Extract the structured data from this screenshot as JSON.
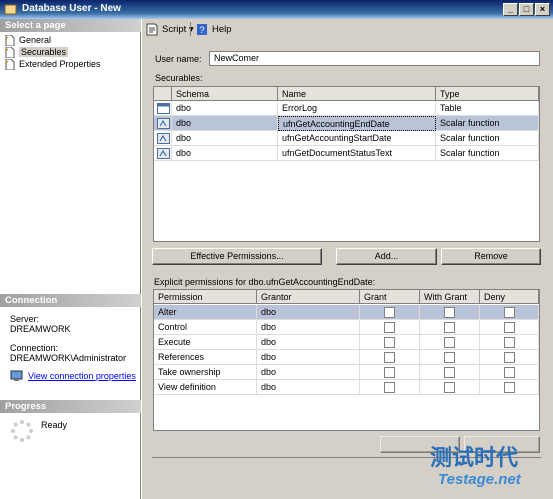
{
  "window": {
    "title": "Database User - New"
  },
  "left": {
    "select_page_header": "Select a page",
    "pages": [
      {
        "label": "General",
        "icon": "page-icon"
      },
      {
        "label": "Securables",
        "icon": "page-icon"
      },
      {
        "label": "Extended Properties",
        "icon": "page-icon"
      }
    ],
    "connection_header": "Connection",
    "server_label": "Server:",
    "server_value": "DREAMWORK",
    "connection_label": "Connection:",
    "connection_value": "DREAMWORK\\Administrator",
    "view_connection_properties": "View connection properties",
    "progress_header": "Progress",
    "progress_status": "Ready"
  },
  "toolbar": {
    "script_label": "Script",
    "help_label": "Help"
  },
  "form": {
    "user_name_label": "User name:",
    "user_name_value": "NewComer",
    "securables_label": "Securables:"
  },
  "securables": {
    "columns": [
      "Schema",
      "Name",
      "Type"
    ],
    "rows": [
      {
        "schema": "dbo",
        "name": "ErrorLog",
        "type": "Table",
        "icon": "table-icon"
      },
      {
        "schema": "dbo",
        "name": "ufnGetAccountingEndDate",
        "type": "Scalar function",
        "icon": "function-icon"
      },
      {
        "schema": "dbo",
        "name": "ufnGetAccountingStartDate",
        "type": "Scalar function",
        "icon": "function-icon"
      },
      {
        "schema": "dbo",
        "name": "ufnGetDocumentStatusText",
        "type": "Scalar function",
        "icon": "function-icon"
      }
    ],
    "selected_row": 1
  },
  "buttons": {
    "effective_permissions": "Effective Permissions...",
    "add": "Add...",
    "remove": "Remove"
  },
  "permissions": {
    "caption": "Explicit permissions for dbo.ufnGetAccountingEndDate:",
    "columns": [
      "Permission",
      "Grantor",
      "Grant",
      "With Grant",
      "Deny"
    ],
    "rows": [
      {
        "permission": "Alter",
        "grantor": "dbo",
        "grant": false,
        "with_grant": false,
        "deny": false
      },
      {
        "permission": "Control",
        "grantor": "dbo",
        "grant": false,
        "with_grant": false,
        "deny": false
      },
      {
        "permission": "Execute",
        "grantor": "dbo",
        "grant": false,
        "with_grant": false,
        "deny": false
      },
      {
        "permission": "References",
        "grantor": "dbo",
        "grant": false,
        "with_grant": false,
        "deny": false
      },
      {
        "permission": "Take ownership",
        "grantor": "dbo",
        "grant": false,
        "with_grant": false,
        "deny": false
      },
      {
        "permission": "View definition",
        "grantor": "dbo",
        "grant": false,
        "with_grant": false,
        "deny": false
      }
    ]
  },
  "watermark": {
    "text_cn": "测试时代",
    "text_url": "Testage.net"
  },
  "colors": {
    "titlebar": "#0a246a",
    "selection": "#b9c4d8",
    "link": "#0000ff",
    "face": "#d4d0c8"
  }
}
